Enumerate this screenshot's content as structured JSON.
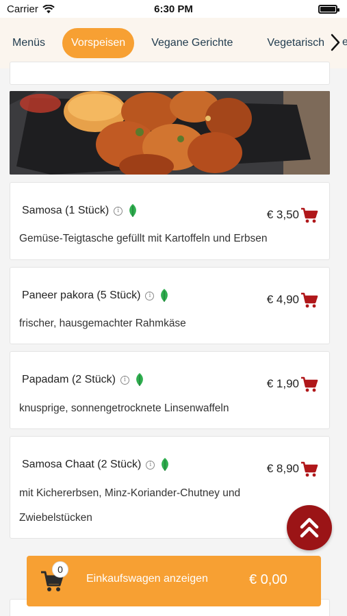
{
  "status_bar": {
    "carrier": "Carrier",
    "time": "6:30 PM"
  },
  "tabs": [
    {
      "label": "Menüs",
      "active": false
    },
    {
      "label": "Vorspeisen",
      "active": true
    },
    {
      "label": "Vegane Gerichte",
      "active": false
    },
    {
      "label": "Vegetarisch",
      "active": false
    }
  ],
  "tabs_overflow_text": "e",
  "items": [
    {
      "name": "Samosa (1 Stück)",
      "price": "€ 3,50",
      "description": [
        "Gemüse-Teigtasche gefüllt mit Kartoffeln und Erbsen"
      ],
      "vegetarian_icon": "leaf-icon"
    },
    {
      "name": "Paneer pakora (5 Stück)",
      "price": "€ 4,90",
      "description": [
        "frischer, hausgemachter Rahmkäse"
      ],
      "vegetarian_icon": "leaf-icon"
    },
    {
      "name": "Papadam (2 Stück)",
      "price": "€ 1,90",
      "description": [
        "knusprige, sonnengetrocknete Linsenwaffeln"
      ],
      "vegetarian_icon": "leaf-icon"
    },
    {
      "name": "Samosa Chaat (2 Stück)",
      "price": "€ 8,90",
      "description": [
        "mit Kichererbsen, Minz-Koriander-Chutney und",
        "Zwiebelstücken"
      ],
      "vegetarian_icon": "leaf-icon"
    }
  ],
  "cart": {
    "count": "0",
    "label": "Einkaufswagen anzeigen",
    "total": "€ 0,00"
  },
  "colors": {
    "accent": "#f7a033",
    "cart_red": "#9b1416",
    "leaf_green": "#2fae4f",
    "tab_text": "#1f3a4d"
  },
  "icons": {
    "scroll_top": "double-chevron-up-icon",
    "tab_next": "chevron-right-icon",
    "cart": "shopping-cart-icon"
  }
}
